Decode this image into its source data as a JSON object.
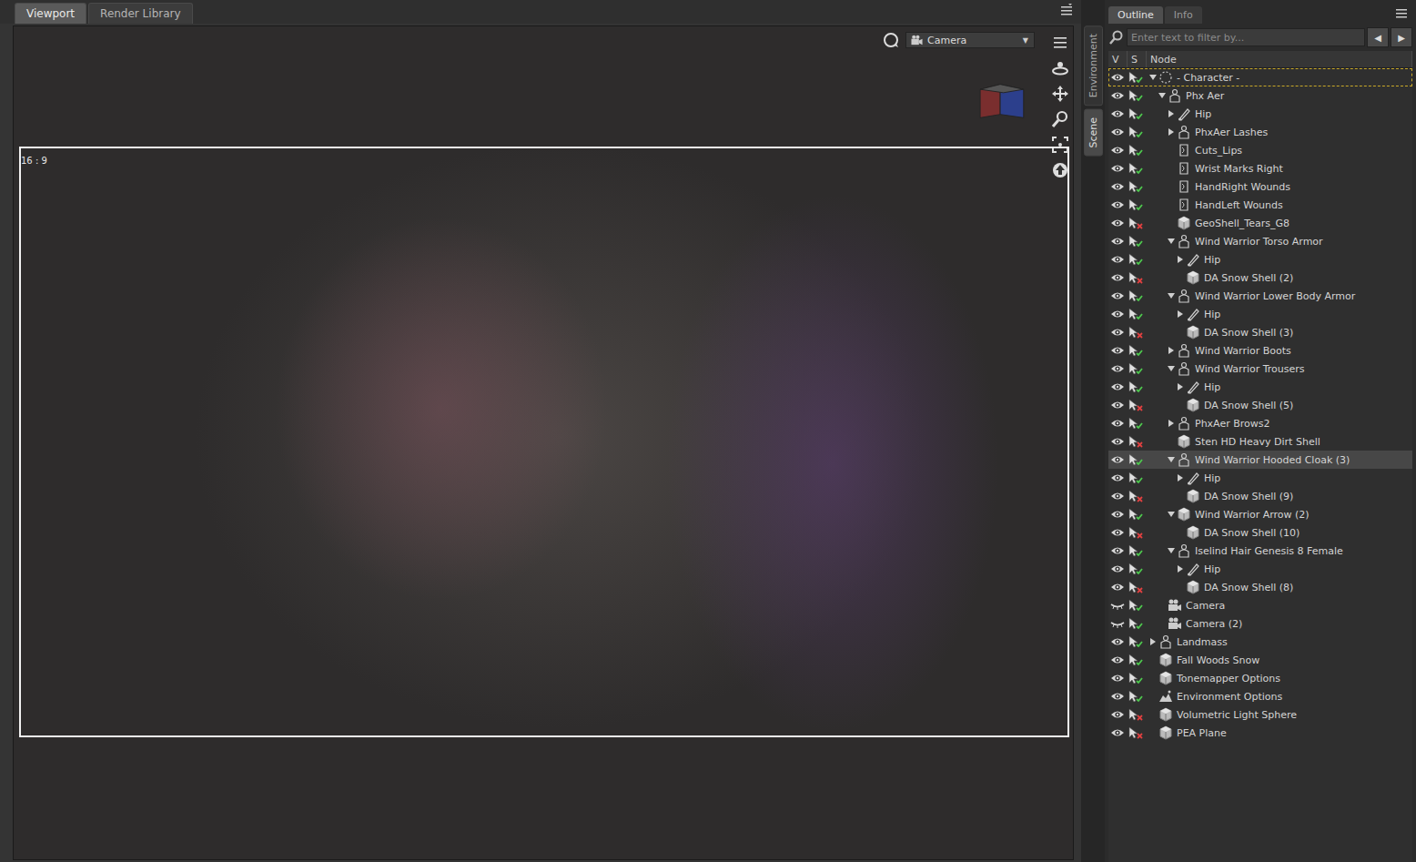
{
  "viewport": {
    "tabs": [
      {
        "label": "Viewport",
        "selected": true
      },
      {
        "label": "Render Library",
        "selected": false
      }
    ],
    "camera": {
      "label": "Camera",
      "arrow": "▼"
    },
    "aspect": "16 : 9"
  },
  "side_tabs": [
    {
      "label": "Environment",
      "selected": false
    },
    {
      "label": "Scene",
      "selected": true
    }
  ],
  "panel": {
    "tabs": [
      {
        "label": "Outline",
        "selected": true
      },
      {
        "label": "Info",
        "selected": false
      }
    ],
    "search": {
      "placeholder": "Enter text to filter by..."
    },
    "nav": [
      "◀",
      "▶"
    ],
    "columns": [
      "V",
      "S",
      "Node"
    ],
    "rows": [
      {
        "label": "- Character -",
        "level": 0,
        "expandable": true,
        "expanded": true,
        "kind": "group",
        "visible": true,
        "selectable": true,
        "selected": false,
        "focused": true
      },
      {
        "label": "Phx Aer",
        "level": 1,
        "expandable": true,
        "expanded": true,
        "kind": "figure",
        "visible": true,
        "selectable": true,
        "selected": false,
        "focused": false
      },
      {
        "label": "Hip",
        "level": 2,
        "expandable": true,
        "expanded": false,
        "kind": "bone",
        "visible": true,
        "selectable": true,
        "selected": false,
        "focused": false
      },
      {
        "label": "PhxAer Lashes",
        "level": 2,
        "expandable": true,
        "expanded": false,
        "kind": "figure",
        "visible": true,
        "selectable": true,
        "selected": false,
        "focused": false
      },
      {
        "label": "Cuts_Lips",
        "level": 2,
        "expandable": false,
        "expanded": false,
        "kind": "geograft",
        "visible": true,
        "selectable": true,
        "selected": false,
        "focused": false
      },
      {
        "label": "Wrist Marks Right",
        "level": 2,
        "expandable": false,
        "expanded": false,
        "kind": "geograft",
        "visible": true,
        "selectable": true,
        "selected": false,
        "focused": false
      },
      {
        "label": "HandRight Wounds",
        "level": 2,
        "expandable": false,
        "expanded": false,
        "kind": "geograft",
        "visible": true,
        "selectable": true,
        "selected": false,
        "focused": false
      },
      {
        "label": "HandLeft Wounds",
        "level": 2,
        "expandable": false,
        "expanded": false,
        "kind": "geograft",
        "visible": true,
        "selectable": true,
        "selected": false,
        "focused": false
      },
      {
        "label": "GeoShell_Tears_G8",
        "level": 2,
        "expandable": false,
        "expanded": false,
        "kind": "prop",
        "visible": true,
        "selectable": false,
        "selected": false,
        "focused": false
      },
      {
        "label": "Wind Warrior Torso Armor",
        "level": 2,
        "expandable": true,
        "expanded": true,
        "kind": "figure",
        "visible": true,
        "selectable": true,
        "selected": false,
        "focused": false
      },
      {
        "label": "Hip",
        "level": 3,
        "expandable": true,
        "expanded": false,
        "kind": "bone",
        "visible": true,
        "selectable": true,
        "selected": false,
        "focused": false
      },
      {
        "label": "DA Snow Shell (2)",
        "level": 3,
        "expandable": false,
        "expanded": false,
        "kind": "prop",
        "visible": true,
        "selectable": false,
        "selected": false,
        "focused": false
      },
      {
        "label": "Wind Warrior Lower Body Armor",
        "level": 2,
        "expandable": true,
        "expanded": true,
        "kind": "figure",
        "visible": true,
        "selectable": true,
        "selected": false,
        "focused": false
      },
      {
        "label": "Hip",
        "level": 3,
        "expandable": true,
        "expanded": false,
        "kind": "bone",
        "visible": true,
        "selectable": true,
        "selected": false,
        "focused": false
      },
      {
        "label": "DA Snow Shell (3)",
        "level": 3,
        "expandable": false,
        "expanded": false,
        "kind": "prop",
        "visible": true,
        "selectable": false,
        "selected": false,
        "focused": false
      },
      {
        "label": "Wind Warrior Boots",
        "level": 2,
        "expandable": true,
        "expanded": false,
        "kind": "figure",
        "visible": true,
        "selectable": true,
        "selected": false,
        "focused": false
      },
      {
        "label": "Wind Warrior Trousers",
        "level": 2,
        "expandable": true,
        "expanded": true,
        "kind": "figure",
        "visible": true,
        "selectable": true,
        "selected": false,
        "focused": false
      },
      {
        "label": "Hip",
        "level": 3,
        "expandable": true,
        "expanded": false,
        "kind": "bone",
        "visible": true,
        "selectable": true,
        "selected": false,
        "focused": false
      },
      {
        "label": "DA Snow Shell (5)",
        "level": 3,
        "expandable": false,
        "expanded": false,
        "kind": "prop",
        "visible": true,
        "selectable": false,
        "selected": false,
        "focused": false
      },
      {
        "label": "PhxAer Brows2",
        "level": 2,
        "expandable": true,
        "expanded": false,
        "kind": "figure",
        "visible": true,
        "selectable": true,
        "selected": false,
        "focused": false
      },
      {
        "label": "Sten HD Heavy Dirt Shell",
        "level": 2,
        "expandable": false,
        "expanded": false,
        "kind": "prop",
        "visible": true,
        "selectable": false,
        "selected": false,
        "focused": false
      },
      {
        "label": "Wind Warrior Hooded Cloak (3)",
        "level": 2,
        "expandable": true,
        "expanded": true,
        "kind": "figure",
        "visible": true,
        "selectable": true,
        "selected": true,
        "focused": false
      },
      {
        "label": "Hip",
        "level": 3,
        "expandable": true,
        "expanded": false,
        "kind": "bone",
        "visible": true,
        "selectable": true,
        "selected": false,
        "focused": false
      },
      {
        "label": "DA Snow Shell (9)",
        "level": 3,
        "expandable": false,
        "expanded": false,
        "kind": "prop",
        "visible": true,
        "selectable": false,
        "selected": false,
        "focused": false
      },
      {
        "label": "Wind Warrior Arrow (2)",
        "level": 2,
        "expandable": true,
        "expanded": true,
        "kind": "prop",
        "visible": true,
        "selectable": true,
        "selected": false,
        "focused": false
      },
      {
        "label": "DA Snow Shell (10)",
        "level": 3,
        "expandable": false,
        "expanded": false,
        "kind": "prop",
        "visible": true,
        "selectable": false,
        "selected": false,
        "focused": false
      },
      {
        "label": "Iselind Hair Genesis 8 Female",
        "level": 2,
        "expandable": true,
        "expanded": true,
        "kind": "figure",
        "visible": true,
        "selectable": true,
        "selected": false,
        "focused": false
      },
      {
        "label": "Hip",
        "level": 3,
        "expandable": true,
        "expanded": false,
        "kind": "bone",
        "visible": true,
        "selectable": true,
        "selected": false,
        "focused": false
      },
      {
        "label": "DA Snow Shell (8)",
        "level": 3,
        "expandable": false,
        "expanded": false,
        "kind": "prop",
        "visible": true,
        "selectable": false,
        "selected": false,
        "focused": false
      },
      {
        "label": "Camera",
        "level": 1,
        "expandable": false,
        "expanded": false,
        "kind": "camera",
        "visible": false,
        "selectable": true,
        "selected": false,
        "focused": false
      },
      {
        "label": "Camera (2)",
        "level": 1,
        "expandable": false,
        "expanded": false,
        "kind": "camera",
        "visible": false,
        "selectable": true,
        "selected": false,
        "focused": false
      },
      {
        "label": "Landmass",
        "level": 0,
        "expandable": true,
        "expanded": false,
        "kind": "figure",
        "visible": true,
        "selectable": true,
        "selected": false,
        "focused": false
      },
      {
        "label": "Fall Woods Snow",
        "level": 0,
        "expandable": false,
        "expanded": false,
        "kind": "prop",
        "visible": true,
        "selectable": true,
        "selected": false,
        "focused": false
      },
      {
        "label": "Tonemapper Options",
        "level": 0,
        "expandable": false,
        "expanded": false,
        "kind": "prop",
        "visible": true,
        "selectable": true,
        "selected": false,
        "focused": false
      },
      {
        "label": "Environment Options",
        "level": 0,
        "expandable": false,
        "expanded": false,
        "kind": "environment",
        "visible": true,
        "selectable": true,
        "selected": false,
        "focused": false
      },
      {
        "label": "Volumetric Light Sphere",
        "level": 0,
        "expandable": false,
        "expanded": false,
        "kind": "prop",
        "visible": true,
        "selectable": false,
        "selected": false,
        "focused": false
      },
      {
        "label": "PEA Plane",
        "level": 0,
        "expandable": false,
        "expanded": false,
        "kind": "prop",
        "visible": true,
        "selectable": false,
        "selected": false,
        "focused": false
      }
    ]
  }
}
